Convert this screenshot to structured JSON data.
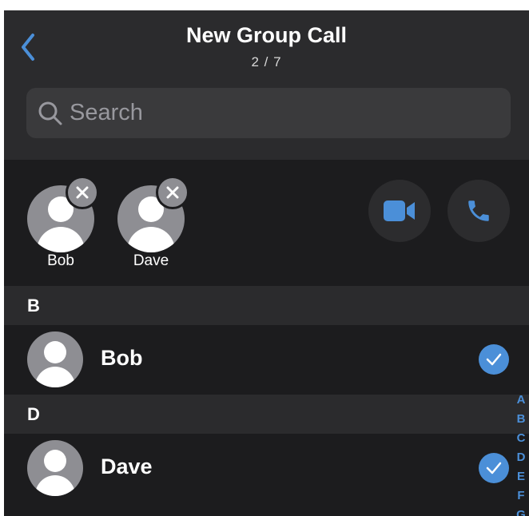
{
  "header": {
    "title": "New Group Call",
    "counter": "2 / 7",
    "back_icon": "chevron-left-icon"
  },
  "search": {
    "placeholder": "Search",
    "value": ""
  },
  "selected_contacts": [
    {
      "name": "Bob"
    },
    {
      "name": "Dave"
    }
  ],
  "call_actions": {
    "video_icon": "video-camera-icon",
    "audio_icon": "phone-icon"
  },
  "sections": [
    {
      "letter": "B",
      "contacts": [
        {
          "name": "Bob",
          "selected": true
        }
      ]
    },
    {
      "letter": "D",
      "contacts": [
        {
          "name": "Dave",
          "selected": true
        }
      ]
    }
  ],
  "alphabet_index": [
    "A",
    "B",
    "C",
    "D",
    "E",
    "F",
    "G"
  ],
  "colors": {
    "accent": "#4b8fd8",
    "background": "#1c1c1e",
    "header_background": "#2b2b2d",
    "avatar": "#8e8e93"
  }
}
